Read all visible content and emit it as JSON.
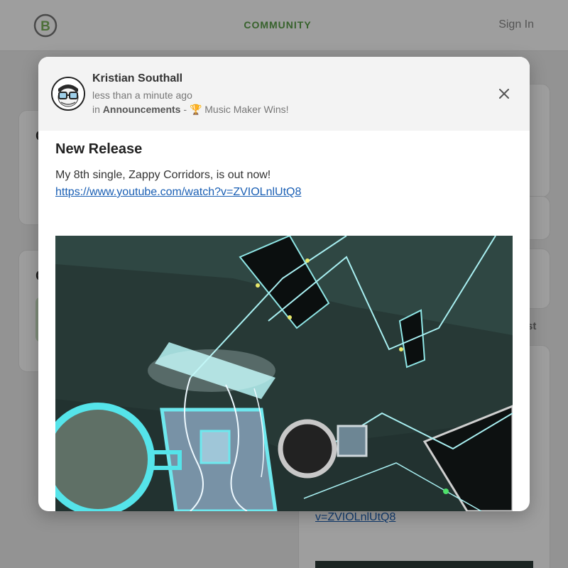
{
  "nav": {
    "community": "COMMUNITY",
    "sign_in": "Sign In",
    "logo_icon": "brand-logo-icon",
    "accent_color": "#5a9e48"
  },
  "background": {
    "card_initial_1": "C",
    "card_initial_2": "C",
    "tab_fragment": "st",
    "link_fragment": "v=ZVIOLnlUtQ8"
  },
  "modal": {
    "author": "Kristian Southall",
    "timestamp": "less than a minute ago",
    "category_prefix": "in",
    "category": "Announcements",
    "separator": "-",
    "topic": "🏆 Music Maker Wins!",
    "close_icon": "close-icon",
    "post": {
      "title": "New Release",
      "text": "My 8th single, Zappy Corridors, is out now!",
      "link": "https://www.youtube.com/watch?v=ZVIOLnlUtQ8",
      "image_icon": "video-thumbnail-image"
    }
  }
}
